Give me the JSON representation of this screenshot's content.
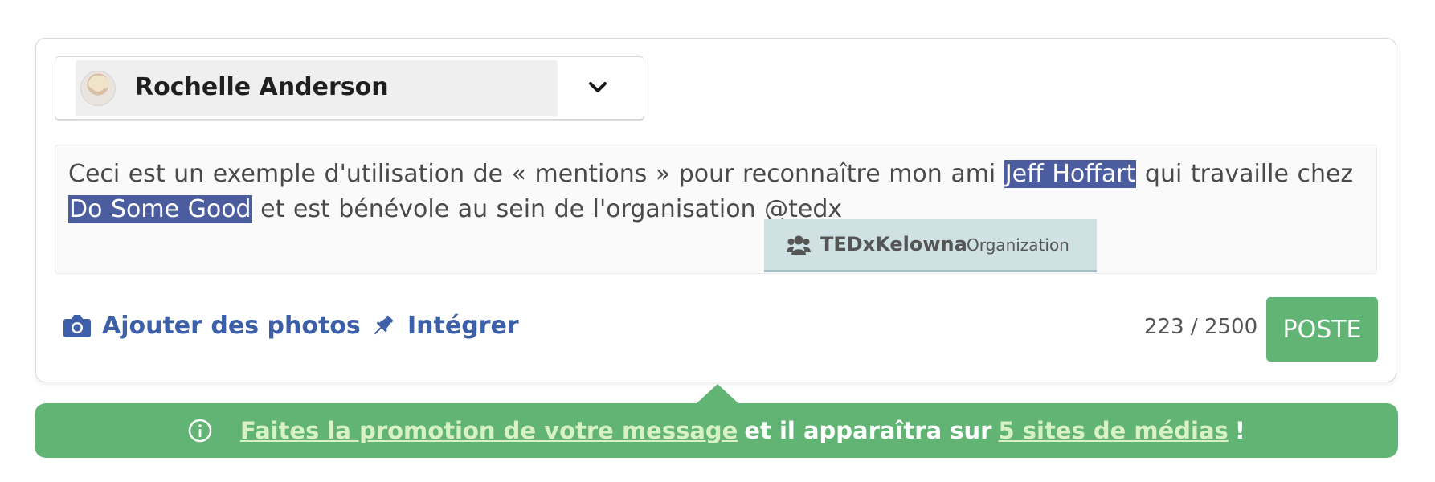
{
  "composer": {
    "account": {
      "name": "Rochelle Anderson",
      "avatar": "user-avatar",
      "dropdown_icon": "chevron-down-icon"
    },
    "editor": {
      "segments": [
        {
          "text": "Ceci est un exemple d'utilisation de « mentions » pour reconnaître mon ami ",
          "mention": false
        },
        {
          "text": "Jeff Hoffart",
          "mention": true
        },
        {
          "text": " qui travaille chez ",
          "mention": false
        },
        {
          "text": "Do Some Good",
          "mention": true
        },
        {
          "text": " et est bénévole au sein de l'organisation @tedx",
          "mention": false
        }
      ],
      "mention_color": "#4b5d9e"
    },
    "mention_suggestion": {
      "icon": "group-icon",
      "name": "TEDxKelowna",
      "type": "Organization"
    },
    "actions": {
      "add_photos": {
        "label": "Ajouter des photos",
        "icon": "camera-icon"
      },
      "embed": {
        "label": "Intégrer",
        "icon": "pin-icon"
      }
    },
    "counter": {
      "current": "223",
      "separator": "/",
      "max": "2500"
    },
    "post_button": {
      "label": "POSTE"
    }
  },
  "promo_banner": {
    "icon": "info-icon",
    "link1": "Faites la promotion de votre message",
    "middle": "et il apparaîtra sur",
    "link2": "5 sites de médias",
    "end": "!"
  },
  "colors": {
    "accent_blue": "#3d5fa8",
    "success_green": "#62b474",
    "suggestion_bg": "#cfe1e3"
  }
}
